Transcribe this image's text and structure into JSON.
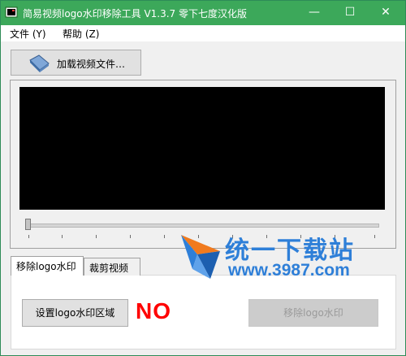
{
  "window": {
    "title": "简易视频logo水印移除工具 V1.3.7 零下七度汉化版",
    "controls": {
      "minimize": "—",
      "maximize": "☐",
      "close": "✕"
    }
  },
  "menu": {
    "file": "文件 (Y)",
    "help": "帮助 (Z)"
  },
  "toolbar": {
    "load_label": "加载视频文件…",
    "load_icon": "video-load-icon"
  },
  "player": {
    "position": 0
  },
  "tabs": [
    {
      "label": "移除logo水印",
      "active": true
    },
    {
      "label": "裁剪视频",
      "active": false
    }
  ],
  "panel": {
    "set_region_label": "设置logo水印区域",
    "status_text": "NO",
    "remove_label": "移除logo水印"
  },
  "watermark": {
    "brand": "统一下载站",
    "url": "www.3987.com"
  },
  "colors": {
    "titlebar": "#3ca85a",
    "status_no": "#ff0000",
    "watermark": "#2e7fd8"
  }
}
